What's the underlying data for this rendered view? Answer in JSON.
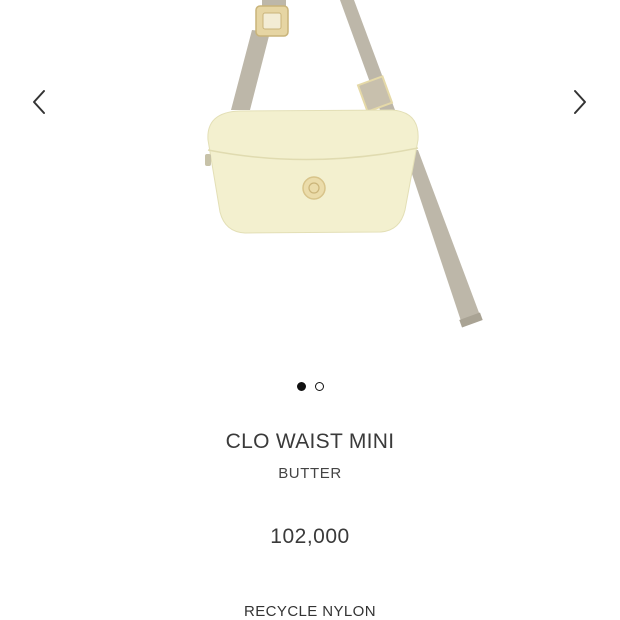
{
  "gallery": {
    "prev_icon": "chevron-left-icon",
    "next_icon": "chevron-right-icon",
    "image_subject": "waist bag",
    "dots": [
      {
        "active": true
      },
      {
        "active": false
      }
    ]
  },
  "product": {
    "name": "CLO WAIST MINI",
    "color": "BUTTER",
    "price": "102,000",
    "material": "RECYCLE NYLON"
  },
  "colors": {
    "bag_body": "#f3f0cf",
    "strap": "#bdb7a9",
    "buckle": "#e6d5a3",
    "text": "#333333",
    "dot": "#111111"
  }
}
